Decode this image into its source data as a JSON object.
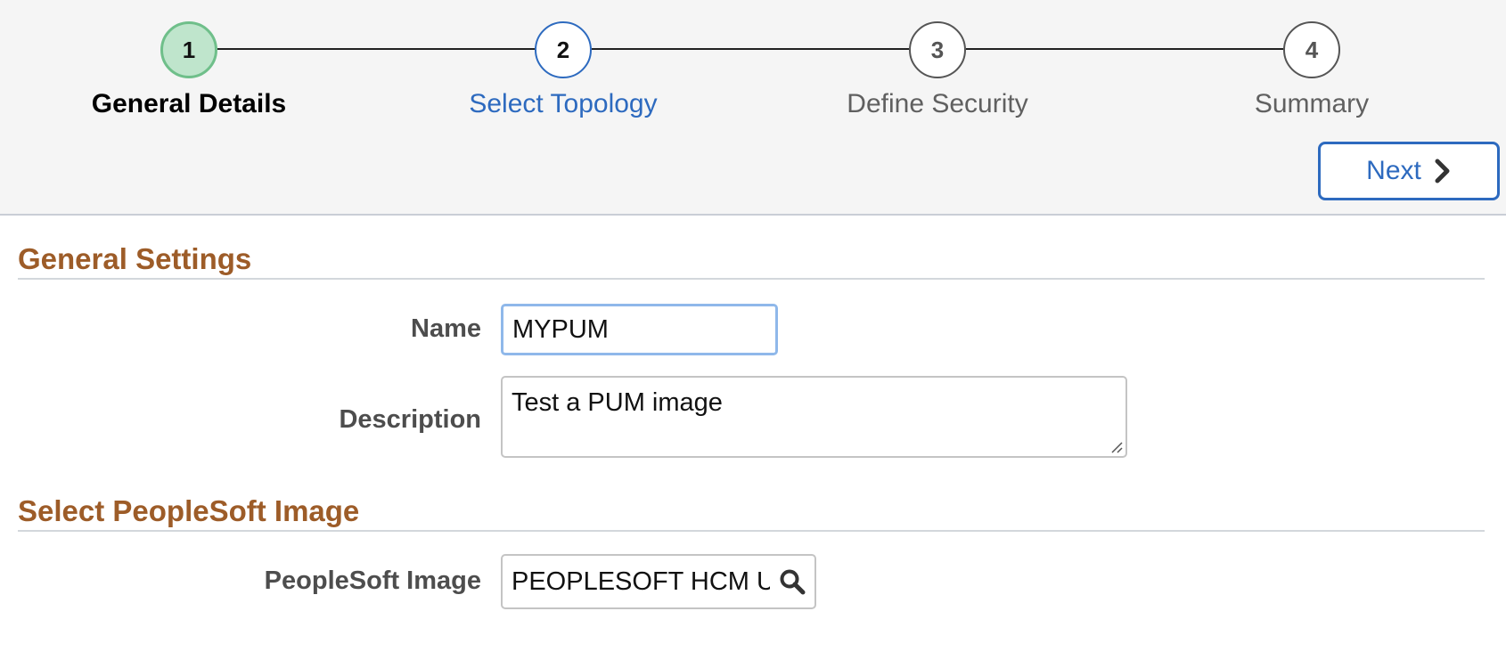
{
  "train": {
    "steps": [
      {
        "number": "1",
        "label": "General Details",
        "state": "complete"
      },
      {
        "number": "2",
        "label": "Select Topology",
        "state": "active"
      },
      {
        "number": "3",
        "label": "Define Security",
        "state": "pending"
      },
      {
        "number": "4",
        "label": "Summary",
        "state": "pending"
      }
    ]
  },
  "toolbar": {
    "next_label": "Next"
  },
  "general_settings": {
    "title": "General Settings",
    "name_label": "Name",
    "name_value": "MYPUM",
    "description_label": "Description",
    "description_value": "Test a PUM image"
  },
  "image_section": {
    "title": "Select PeopleSoft Image",
    "image_label": "PeopleSoft Image",
    "image_value": "PEOPLESOFT HCM U"
  },
  "colors": {
    "accent_blue": "#2d6abf",
    "complete_green_fill": "#bfe5cc",
    "complete_green_border": "#6fbf8a",
    "section_heading": "#9d5c28",
    "focus_border": "#8fb8ea"
  },
  "icons": {
    "next": "chevron-right-icon",
    "lookup": "search-icon",
    "resize": "resize-grip-icon"
  }
}
